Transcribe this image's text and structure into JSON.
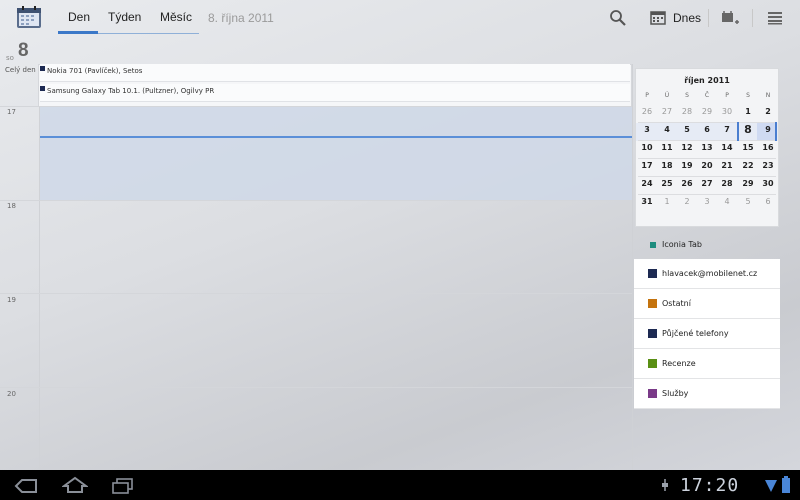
{
  "app": {
    "tabs": [
      {
        "label": "Den",
        "active": true
      },
      {
        "label": "Týden",
        "active": false
      },
      {
        "label": "Měsíc",
        "active": false
      }
    ],
    "date_title": "8. října 2011",
    "today_label": "Dnes"
  },
  "day": {
    "abbrev": "so",
    "number": "8",
    "allday_label": "Celý den",
    "events": [
      {
        "title": "Nokia 701 (Pavlíček), Setos"
      },
      {
        "title": "Samsung Galaxy Tab 10.1. (Pultzner), Ogilvy PR"
      }
    ],
    "hours": [
      "17",
      "18",
      "19",
      "20"
    ]
  },
  "mini_calendar": {
    "title": "říjen 2011",
    "dow": [
      "P",
      "Ú",
      "S",
      "Č",
      "P",
      "S",
      "N"
    ],
    "weeks": [
      [
        "26",
        "27",
        "28",
        "29",
        "30",
        "1",
        "2"
      ],
      [
        "3",
        "4",
        "5",
        "6",
        "7",
        "8",
        "9"
      ],
      [
        "10",
        "11",
        "12",
        "13",
        "14",
        "15",
        "16"
      ],
      [
        "17",
        "18",
        "19",
        "20",
        "21",
        "22",
        "23"
      ],
      [
        "24",
        "25",
        "26",
        "27",
        "28",
        "29",
        "30"
      ],
      [
        "31",
        "1",
        "2",
        "3",
        "4",
        "5",
        "6"
      ]
    ]
  },
  "calendars": [
    {
      "name": "Iconia Tab",
      "color": "#1e8c7e"
    },
    {
      "name": "hlavacek@mobilenet.cz",
      "color": "#1d2a52"
    },
    {
      "name": "Ostatní",
      "color": "#c4730e"
    },
    {
      "name": "Půjčené telefony",
      "color": "#1d2a52"
    },
    {
      "name": "Recenze",
      "color": "#5a8f14"
    },
    {
      "name": "Služby",
      "color": "#7a3a88"
    }
  ],
  "status_bar": {
    "clock": "17:20"
  },
  "colors": {
    "accent": "#3b78c8",
    "event_marker": "#1d2a52",
    "now_line": "#5b8fd8"
  }
}
